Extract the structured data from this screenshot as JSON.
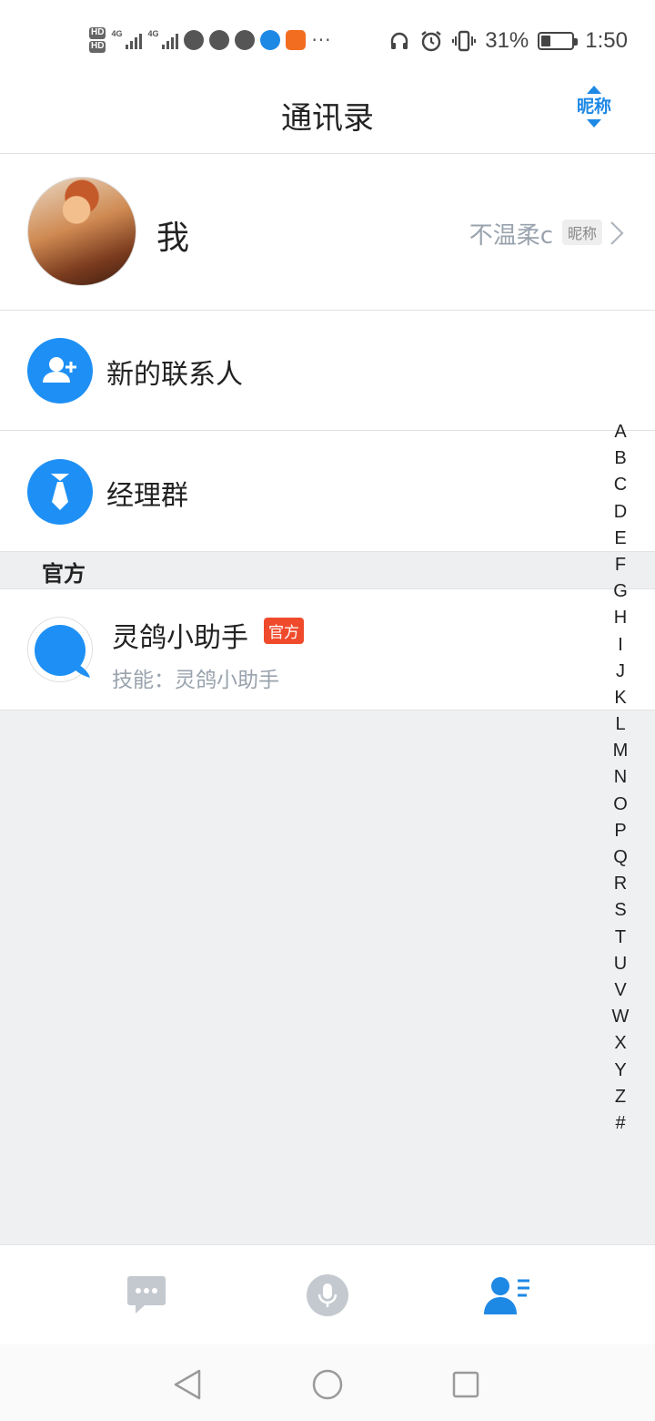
{
  "status_bar": {
    "hd1": "HD",
    "hd2": "HD",
    "net1": "4G",
    "net2": "4G",
    "more": "···",
    "battery_text": "31%",
    "battery_level": 0.31,
    "time": "1:50"
  },
  "header": {
    "title": "通讯录",
    "sort_label": "昵称"
  },
  "me": {
    "name": "我",
    "nickname": "不温柔c",
    "nick_tag": "昵称"
  },
  "functions": {
    "new_contact": "新的联系人",
    "manager_group": "经理群"
  },
  "section": {
    "title": "官方"
  },
  "contacts": [
    {
      "name": "灵鸽小助手",
      "badge": "官方",
      "skill": "技能：灵鸽小助手"
    }
  ],
  "alpha_index": [
    "A",
    "B",
    "C",
    "D",
    "E",
    "F",
    "G",
    "H",
    "I",
    "J",
    "K",
    "L",
    "M",
    "N",
    "O",
    "P",
    "Q",
    "R",
    "S",
    "T",
    "U",
    "V",
    "W",
    "X",
    "Y",
    "Z",
    "#"
  ],
  "tabs": {
    "chat_icon": "chat-bubble-icon",
    "voice_icon": "microphone-icon",
    "contacts_icon": "contacts-icon",
    "active_color": "#1e88e5",
    "inactive_color": "#c4c9cf"
  }
}
